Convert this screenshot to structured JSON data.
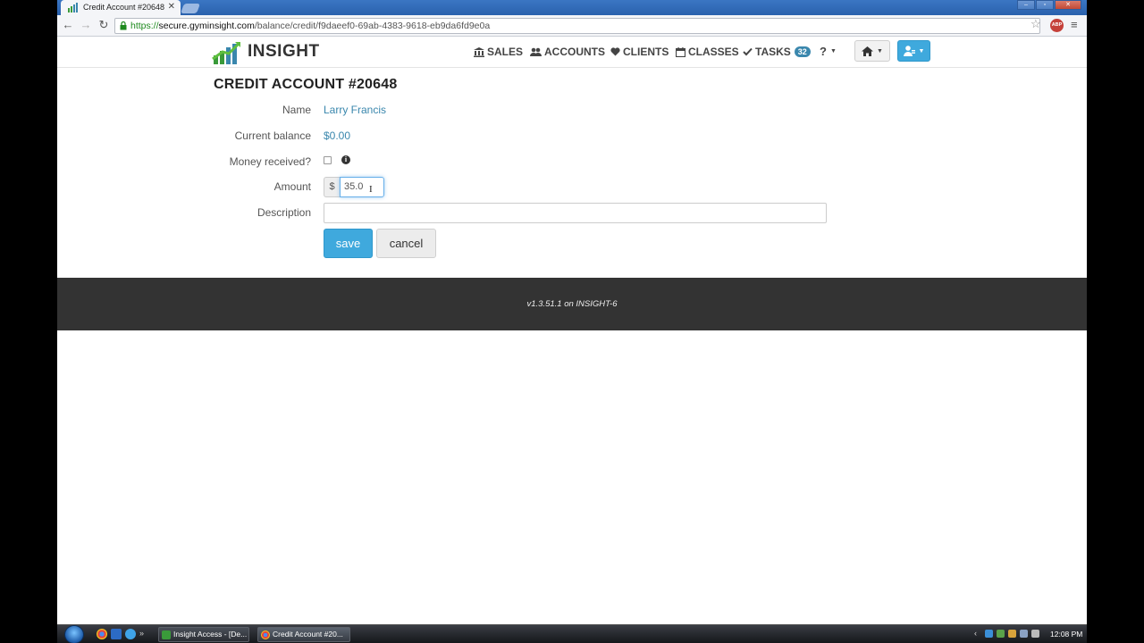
{
  "browser": {
    "tab_title": "Credit Account #20648",
    "url_scheme": "https://",
    "url_host": "secure.gyminsight.com",
    "url_path": "/balance/credit/f9daeef0-69ab-4383-9618-eb9da6fd9e0a",
    "adblock_label": "ABP"
  },
  "navbar": {
    "logo_text": "INSIGHT",
    "items": [
      {
        "label": "SALES",
        "icon": "bank-icon"
      },
      {
        "label": "ACCOUNTS",
        "icon": "users-icon"
      },
      {
        "label": "CLIENTS",
        "icon": "heart-icon"
      },
      {
        "label": "CLASSES",
        "icon": "calendar-icon"
      },
      {
        "label": "TASKS",
        "icon": "check-icon"
      }
    ],
    "tasks_badge": "32",
    "help_label": "?"
  },
  "form": {
    "title": "CREDIT ACCOUNT #20648",
    "name_label": "Name",
    "name_value": "Larry Francis",
    "balance_label": "Current balance",
    "balance_value": "$0.00",
    "money_label": "Money received?",
    "money_received_checked": false,
    "amount_label": "Amount",
    "amount_addon": "$",
    "amount_value": "35.0",
    "description_label": "Description",
    "description_value": "",
    "save_label": "save",
    "cancel_label": "cancel"
  },
  "footer": {
    "version": "v1.3.51.1 on INSIGHT-6"
  },
  "taskbar": {
    "task_insight": "Insight Access - [De...",
    "task_chrome": "Credit Account #20...",
    "clock": "12:08 PM"
  },
  "colors": {
    "accent": "#3fa9dd",
    "link": "#3a87ad",
    "footer_bg": "#333333"
  }
}
